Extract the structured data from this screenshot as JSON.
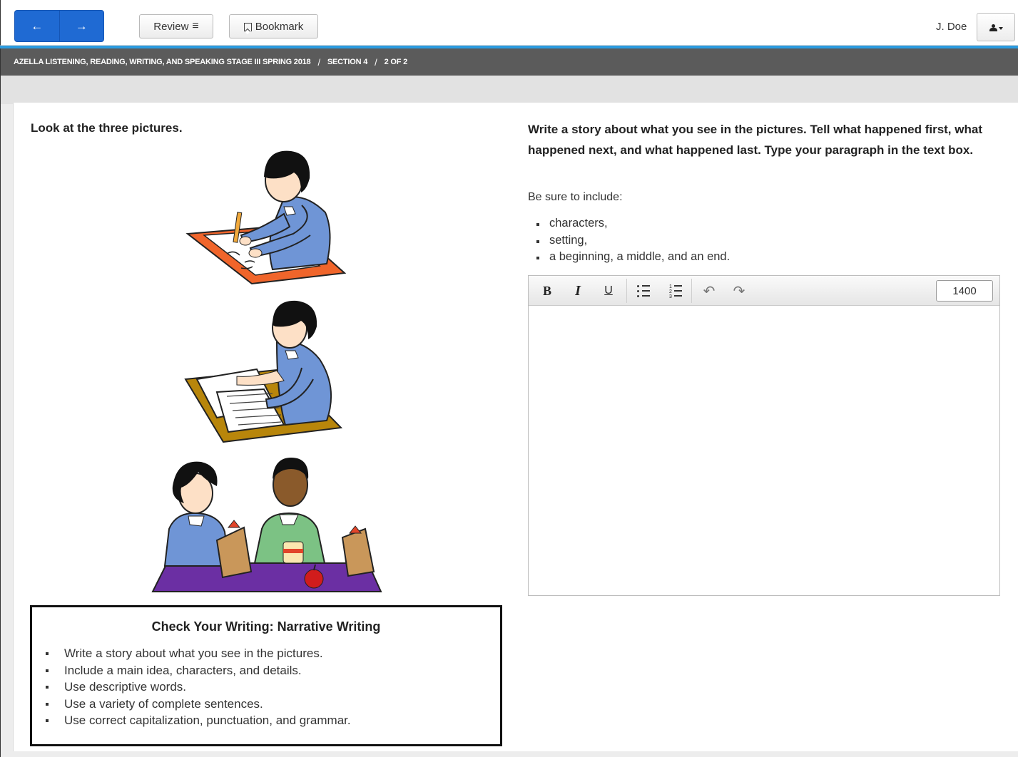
{
  "toolbar": {
    "back_label": "←",
    "forward_label": "→",
    "review_label": "Review",
    "review_icon": "≡",
    "bookmark_label": "Bookmark",
    "user_name": "J. Doe"
  },
  "breadcrumb": {
    "test": "AZELLA LISTENING, READING, WRITING, AND SPEAKING STAGE III SPRING 2018",
    "separator": "/",
    "section": "SECTION 4",
    "page": "2 OF 2"
  },
  "left": {
    "instruction": "Look at the three pictures.",
    "checklist": {
      "title": "Check Your Writing: Narrative Writing",
      "items": [
        "Write a story about what you see in the pictures.",
        "Include a main idea, characters, and details.",
        "Use descriptive words.",
        "Use a variety of complete sentences.",
        "Use correct capitalization, punctuation, and grammar."
      ]
    }
  },
  "right": {
    "prompt": "Write a story about what you see in the pictures. Tell what happened first, what happened next, and what happened last. Type your paragraph in the text box.",
    "be_sure": "Be sure to include:",
    "bullets": [
      "characters,",
      "setting,",
      "a beginning, a middle, and an end."
    ],
    "editor": {
      "bold": "B",
      "italic": "I",
      "underline": "U",
      "undo": "↶",
      "redo": "↷",
      "char_count": "1400",
      "value": ""
    }
  },
  "colors": {
    "nav_blue": "#1f6ad3",
    "accent_line": "#2a9be0",
    "breadcrumb_bg": "#5b5b5b"
  }
}
